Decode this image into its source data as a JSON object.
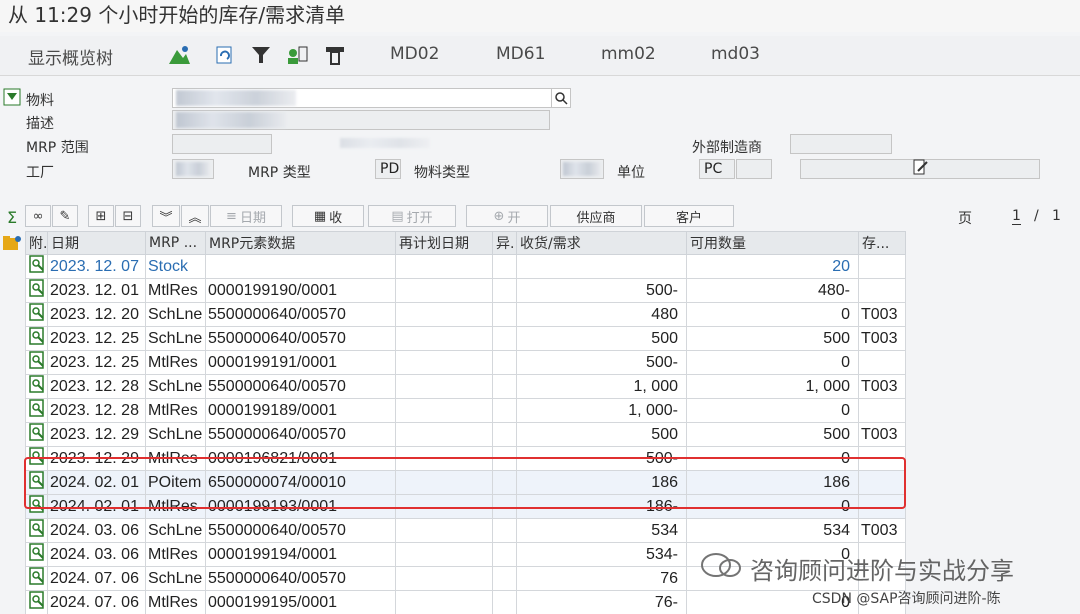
{
  "title": "从 11:29 个小时开始的库存/需求清单",
  "appbar": {
    "show_tree": "显示概览树",
    "buttons": [
      "MD02",
      "MD61",
      "mm02",
      "md03"
    ]
  },
  "header": {
    "material_label": "物料",
    "desc_label": "描述",
    "mrp_area_label": "MRP 范围",
    "plant_label": "工厂",
    "mrp_type_label": "MRP 类型",
    "mrp_type_value": "PD",
    "material_type_label": "物料类型",
    "unit_label": "单位",
    "unit_value": "PC",
    "ext_proc_label": "外部制造商"
  },
  "toolbar2": {
    "date_btn": "日期",
    "receipt_btn": "收",
    "open_btn": "打开",
    "open2_btn": "开",
    "vendor_btn": "供应商",
    "customer_btn": "客户",
    "page_label": "页",
    "page_current": "1",
    "page_sep": "/",
    "page_total": "1"
  },
  "grid": {
    "columns": [
      "附.",
      "日期",
      "MRP ...",
      "MRP元素数据",
      "再计划日期",
      "异.",
      "收货/需求",
      "可用数量",
      "存..."
    ],
    "rows": [
      {
        "date": "2023. 12. 07",
        "mrp": "Stock",
        "data": "",
        "qty": "",
        "avail": "20",
        "stor": "",
        "type": "stock"
      },
      {
        "date": "2023. 12. 01",
        "mrp": "MtlRes",
        "data": "0000199190/0001",
        "qty": "500-",
        "avail": "480-",
        "stor": ""
      },
      {
        "date": "2023. 12. 20",
        "mrp": "SchLne",
        "data": "5500000640/00570",
        "qty": "480",
        "avail": "0",
        "stor": "T003"
      },
      {
        "date": "2023. 12. 25",
        "mrp": "SchLne",
        "data": "5500000640/00570",
        "qty": "500",
        "avail": "500",
        "stor": "T003"
      },
      {
        "date": "2023. 12. 25",
        "mrp": "MtlRes",
        "data": "0000199191/0001",
        "qty": "500-",
        "avail": "0",
        "stor": ""
      },
      {
        "date": "2023. 12. 28",
        "mrp": "SchLne",
        "data": "5500000640/00570",
        "qty": "1, 000",
        "avail": "1, 000",
        "stor": "T003"
      },
      {
        "date": "2023. 12. 28",
        "mrp": "MtlRes",
        "data": "0000199189/0001",
        "qty": "1, 000-",
        "avail": "0",
        "stor": ""
      },
      {
        "date": "2023. 12. 29",
        "mrp": "SchLne",
        "data": "5500000640/00570",
        "qty": "500",
        "avail": "500",
        "stor": "T003"
      },
      {
        "date": "2023. 12. 29",
        "mrp": "MtlRes",
        "data": "0000196821/0001",
        "qty": "500-",
        "avail": "0",
        "stor": ""
      },
      {
        "date": "2024. 02. 01",
        "mrp": "POitem",
        "data": "6500000074/00010",
        "qty": "186",
        "avail": "186",
        "stor": "",
        "type": "hl"
      },
      {
        "date": "2024. 02. 01",
        "mrp": "MtlRes",
        "data": "0000199193/0001",
        "qty": "186-",
        "avail": "0",
        "stor": "",
        "type": "hl"
      },
      {
        "date": "2024. 03. 06",
        "mrp": "SchLne",
        "data": "5500000640/00570",
        "qty": "534",
        "avail": "534",
        "stor": "T003"
      },
      {
        "date": "2024. 03. 06",
        "mrp": "MtlRes",
        "data": "0000199194/0001",
        "qty": "534-",
        "avail": "0",
        "stor": ""
      },
      {
        "date": "2024. 07. 06",
        "mrp": "SchLne",
        "data": "5500000640/00570",
        "qty": "76",
        "avail": "",
        "stor": ""
      },
      {
        "date": "2024. 07. 06",
        "mrp": "MtlRes",
        "data": "0000199195/0001",
        "qty": "76-",
        "avail": "0",
        "stor": ""
      }
    ]
  },
  "watermark": {
    "main": "咨询顾问进阶与实战分享",
    "sub": "CSDN @SAP咨询顾问进阶-陈"
  },
  "colors": {
    "accent": "#2a6db2",
    "highlight": "#e03030"
  }
}
